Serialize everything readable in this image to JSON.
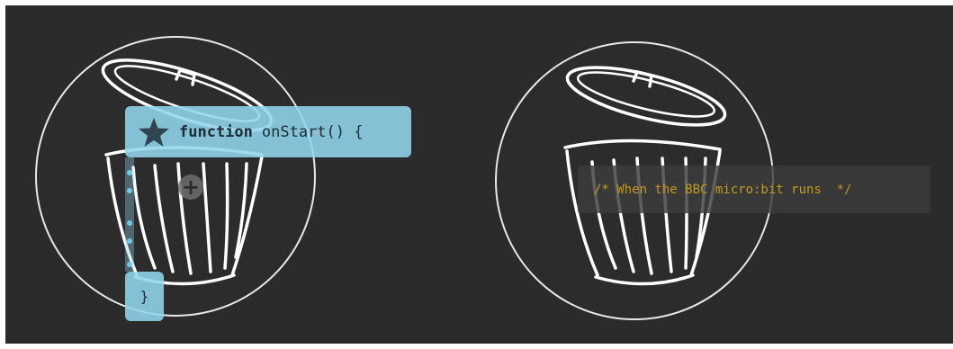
{
  "function_block": {
    "keyword": "function",
    "signature": "onStart() {",
    "closing": "}"
  },
  "comment_block": {
    "text": "/* When the BBC micro:bit runs  */"
  },
  "icons": {
    "left_trash": "trash-can-icon",
    "right_trash": "trash-can-icon",
    "event_star": "star-icon",
    "add": "plus-icon"
  },
  "colors": {
    "background": "#2b2b2b",
    "block_blue": "#92d6ec",
    "comment_text": "#c49a1c",
    "outline": "#ffffff"
  }
}
